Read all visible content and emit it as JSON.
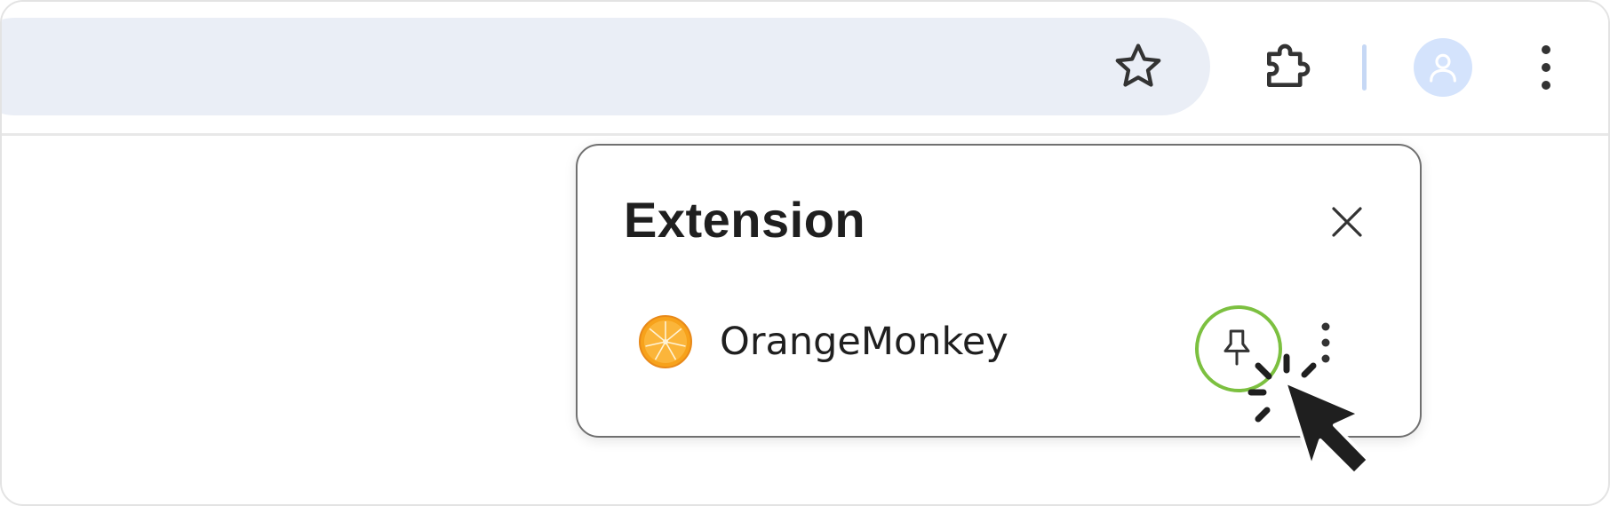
{
  "popup": {
    "title": "Extension",
    "extensions": [
      {
        "name": "OrangeMonkey",
        "icon": "orange-slice-icon"
      }
    ]
  },
  "icons": {
    "bookmark": "star-outline-icon",
    "extensions": "puzzle-piece-icon",
    "profile": "person-icon",
    "menu": "vertical-dots-icon",
    "close": "close-icon",
    "pin": "pin-icon",
    "cursor": "mouse-pointer-icon"
  },
  "colors": {
    "omnibox_bg": "#eaeef6",
    "avatar_bg": "#d4e3fc",
    "avatar_fg": "#ffffff",
    "divider": "#c6d8f5",
    "pin_highlight": "#7cc040",
    "orange": "#f7a21b",
    "text": "#1f1f1f",
    "cursor": "#1f1f1f"
  }
}
